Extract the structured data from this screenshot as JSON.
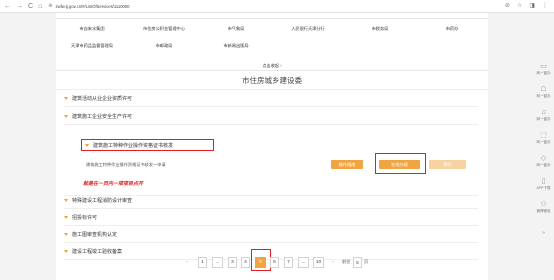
{
  "browser": {
    "back_icon": "←",
    "forward_icon": "→",
    "reload_icon": "C",
    "home_icon": "⌂",
    "url": "zwfw.tj.gov.cn/#/ListOfServices/1110000",
    "right_icons": [
      "⊘",
      "☆",
      "◨",
      "⋮"
    ]
  },
  "top_grid": {
    "row1": [
      "",
      "",
      "",
      "",
      "",
      ""
    ],
    "row2": [
      "市自来水集团",
      "市住房公积金管理中心",
      "市气象局",
      "人民银行天津分行",
      "市税务局",
      "市药办"
    ],
    "row3": [
      "天津市药品监督管理局",
      "市邮政局",
      "市新闻出版局"
    ]
  },
  "collapse_label": "点击收起 ›",
  "section_title": "市住房城乡建设委",
  "items": {
    "i1": "建筑活动从业企业资质许可",
    "i2": "建筑施工企业安全生产许可",
    "i3": "建筑施工特种作业操作资格证书核发",
    "sub": "建筑施工特种作业操作资格证书核发—申请",
    "note": "就是在一页内一项项目点开",
    "i4": "特殊建设工程消防设计审查",
    "i5": "招投标许可",
    "i6": "施工图审查机构认定",
    "i7": "建设工程竣工验收备案"
  },
  "buttons": {
    "guide": "操作指南",
    "online": "在线办理",
    "other": "预约"
  },
  "pagination": {
    "prev": "‹",
    "pages": [
      "1",
      "...",
      "3",
      "4",
      "5",
      "6",
      "7",
      "...",
      "10"
    ],
    "next": "›",
    "goto_prefix": "前往",
    "goto_value": "5",
    "goto_suffix": "页",
    "active_page": "5"
  },
  "sidebar": {
    "items": [
      {
        "icon": "▭",
        "label": "网一窗办"
      },
      {
        "icon": "☖",
        "label": "网一窗办"
      },
      {
        "icon": "♫",
        "label": "网一窗办"
      },
      {
        "icon": "⬚",
        "label": "网一窗办"
      },
      {
        "icon": "◇",
        "label": "网一窗办"
      },
      {
        "icon": "▯",
        "label": "APP下载"
      },
      {
        "icon": "⚇",
        "label": "微博微信"
      }
    ]
  }
}
